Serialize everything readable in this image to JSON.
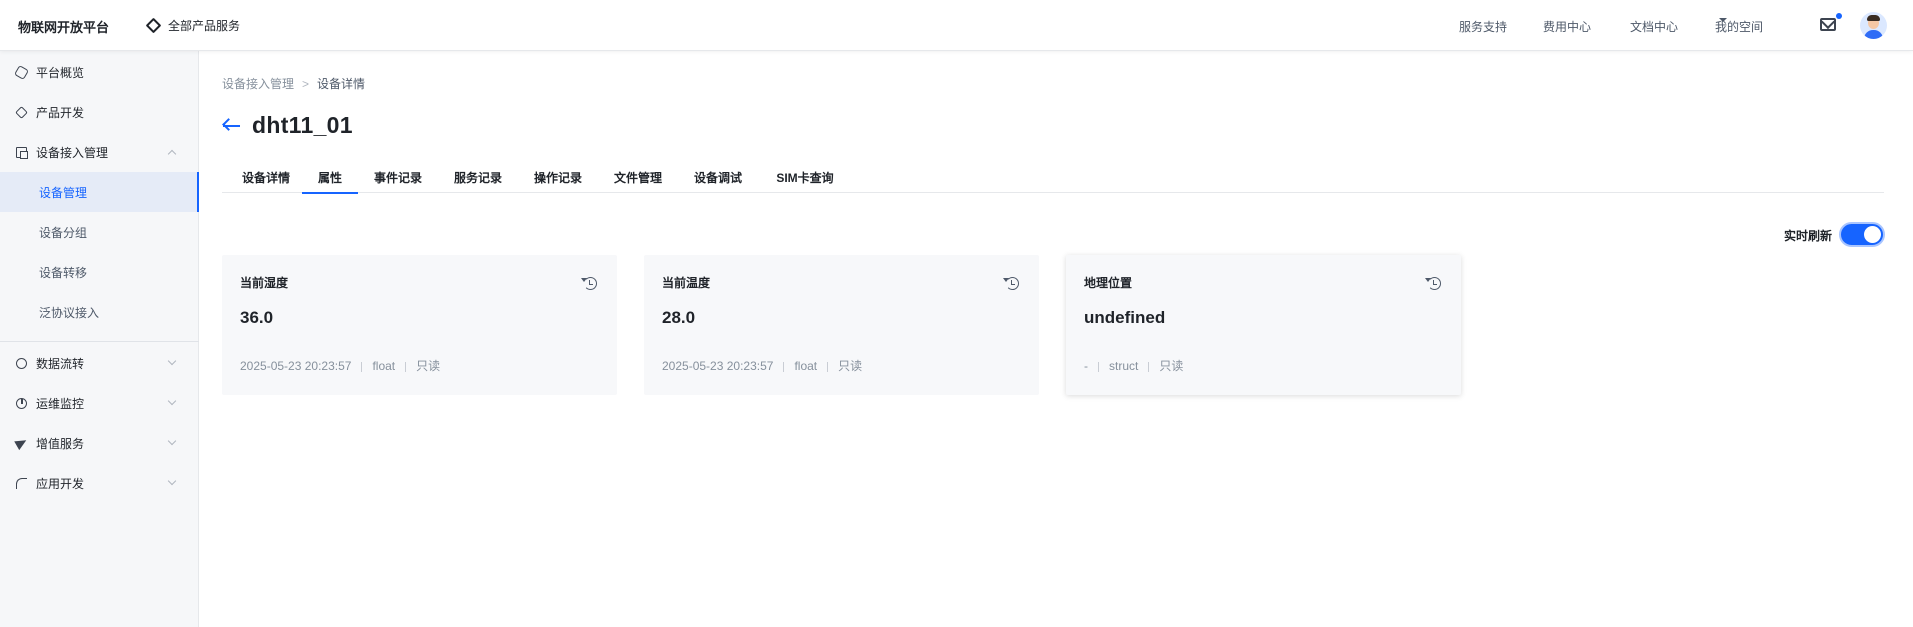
{
  "header": {
    "brand": "物联网开放平台",
    "all_products": "全部产品服务",
    "links": {
      "support": "服务支持",
      "billing": "费用中心",
      "docs": "文档中心",
      "my_space": "我的空间"
    }
  },
  "sidebar": {
    "items": [
      {
        "label": "平台概览",
        "icon": "hexagon-icon"
      },
      {
        "label": "产品开发",
        "icon": "cube-icon"
      },
      {
        "label": "设备接入管理",
        "icon": "device-icon",
        "expanded": true
      }
    ],
    "sub_items": [
      {
        "label": "设备管理",
        "active": true
      },
      {
        "label": "设备分组"
      },
      {
        "label": "设备转移"
      },
      {
        "label": "泛协议接入"
      }
    ],
    "more_items": [
      {
        "label": "数据流转",
        "icon": "flow-icon"
      },
      {
        "label": "运维监控",
        "icon": "pie-chart-icon"
      },
      {
        "label": "增值服务",
        "icon": "paper-plane-icon"
      },
      {
        "label": "应用开发",
        "icon": "wave-icon"
      }
    ]
  },
  "breadcrumb": {
    "parent": "设备接入管理",
    "separator": ">",
    "current": "设备详情"
  },
  "device": {
    "title": "dht11_01"
  },
  "tabs": [
    {
      "label": "设备详情"
    },
    {
      "label": "属性",
      "active": true
    },
    {
      "label": "事件记录"
    },
    {
      "label": "服务记录"
    },
    {
      "label": "操作记录"
    },
    {
      "label": "文件管理"
    },
    {
      "label": "设备调试"
    },
    {
      "label": "SIM卡查询"
    }
  ],
  "realtime_refresh": {
    "label": "实时刷新",
    "enabled": true
  },
  "properties": [
    {
      "name": "当前湿度",
      "value": "36.0",
      "time": "2025-05-23 20:23:57",
      "type": "float",
      "access": "只读"
    },
    {
      "name": "当前温度",
      "value": "28.0",
      "time": "2025-05-23 20:23:57",
      "type": "float",
      "access": "只读"
    },
    {
      "name": "地理位置",
      "value": "undefined",
      "time": "-",
      "type": "struct",
      "access": "只读"
    }
  ],
  "colors": {
    "accent": "#1664ff",
    "sidebar_bg": "#f6f7f9",
    "card_bg": "#f7f8fa"
  }
}
